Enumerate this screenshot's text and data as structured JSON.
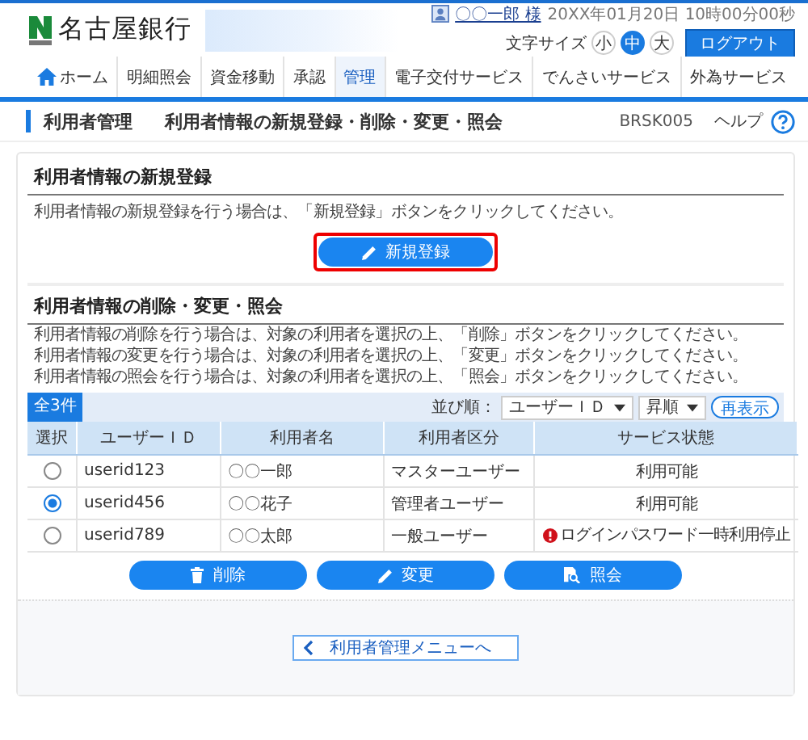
{
  "header": {
    "bank_name": "名古屋銀行",
    "user_name": "〇〇一郎 様",
    "datetime": "20XX年01月20日 10時00分00秒",
    "font_size_label": "文字サイズ",
    "font_sizes": [
      {
        "label": "小",
        "selected": false
      },
      {
        "label": "中",
        "selected": true
      },
      {
        "label": "大",
        "selected": false
      }
    ],
    "logout": "ログアウト"
  },
  "nav": [
    {
      "label": "ホーム",
      "selected": false,
      "kind": "home"
    },
    {
      "label": "明細照会",
      "selected": false
    },
    {
      "label": "資金移動",
      "selected": false
    },
    {
      "label": "承認",
      "selected": false
    },
    {
      "label": "管理",
      "selected": true
    },
    {
      "label": "電子交付サービス",
      "selected": false
    },
    {
      "label": "でんさいサービス",
      "selected": false
    },
    {
      "label": "外為サービス",
      "selected": false
    }
  ],
  "page": {
    "category": "利用者管理",
    "title": "利用者情報の新規登録・削除・変更・照会",
    "screen_id": "BRSK005",
    "help": "ヘルプ"
  },
  "new_section": {
    "heading": "利用者情報の新規登録",
    "text": "利用者情報の新規登録を行う場合は、「新規登録」ボタンをクリックしてください。",
    "button": "新規登録"
  },
  "edit_section": {
    "heading": "利用者情報の削除・変更・照会",
    "texts": [
      "利用者情報の削除を行う場合は、対象の利用者を選択の上、「削除」ボタンをクリックしてください。",
      "利用者情報の変更を行う場合は、対象の利用者を選択の上、「変更」ボタンをクリックしてください。",
      "利用者情報の照会を行う場合は、対象の利用者を選択の上、「照会」ボタンをクリックしてください。"
    ],
    "count": "全3件",
    "sort_label": "並び順：",
    "sort_key": "ユーザーＩＤ",
    "sort_order": "昇順",
    "refresh": "再表示",
    "columns": [
      "選択",
      "ユーザーＩＤ",
      "利用者名",
      "利用者区分",
      "サービス状態"
    ],
    "rows": [
      {
        "selected": false,
        "user_id": "userid123",
        "name": "〇〇一郎",
        "type": "マスターユーザー",
        "status": "利用可能",
        "alert": false
      },
      {
        "selected": true,
        "user_id": "userid456",
        "name": "〇〇花子",
        "type": "管理者ユーザー",
        "status": "利用可能",
        "alert": false
      },
      {
        "selected": false,
        "user_id": "userid789",
        "name": "〇〇太郎",
        "type": "一般ユーザー",
        "status": "ログインパスワード一時利用停止",
        "alert": true
      }
    ],
    "buttons": [
      {
        "label": "削除",
        "kind": "delete"
      },
      {
        "label": "変更",
        "kind": "edit"
      },
      {
        "label": "照会",
        "kind": "view"
      }
    ]
  },
  "back_button": "利用者管理メニューへ"
}
